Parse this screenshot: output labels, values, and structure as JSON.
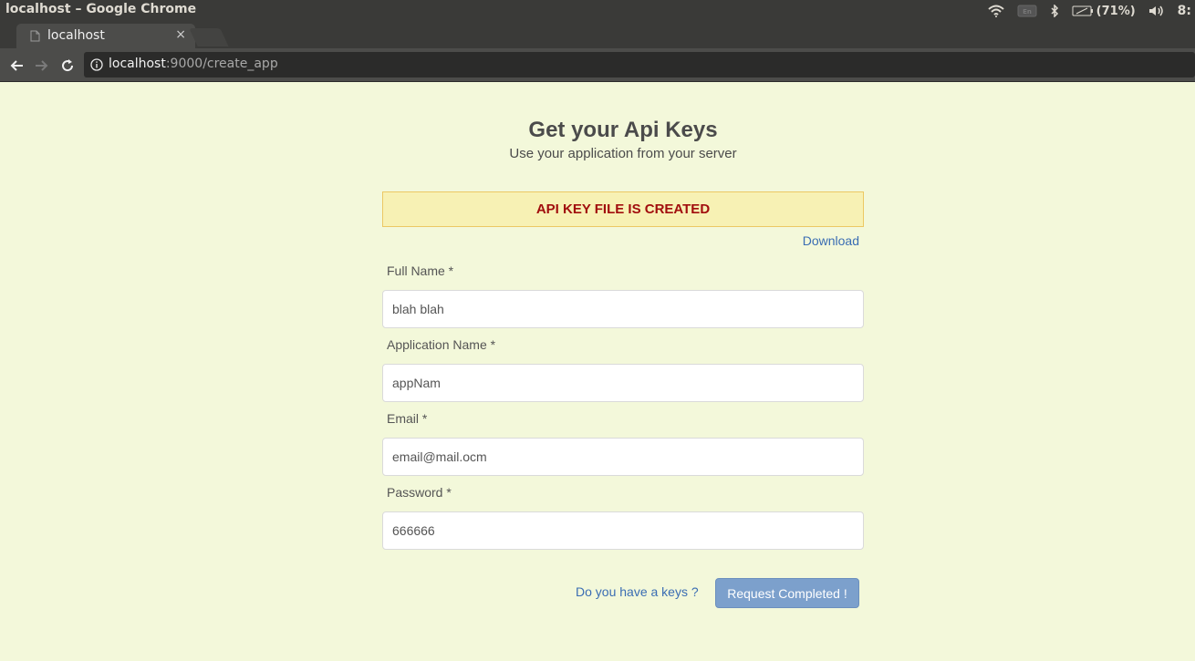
{
  "window": {
    "title": "localhost – Google Chrome"
  },
  "tray": {
    "battery_label": "(71%)",
    "clock": "8:"
  },
  "browser": {
    "tab_title": "localhost",
    "tab_close": "×",
    "url_host": "localhost",
    "url_path": ":9000/create_app"
  },
  "page": {
    "title": "Get your Api Keys",
    "subtitle": "Use your application from your server",
    "alert_text": "API KEY FILE IS CREATED",
    "download_link": "Download",
    "form": {
      "full_name_label": "Full Name *",
      "full_name_value": "blah blah",
      "app_name_label": "Application Name *",
      "app_name_value": "appNam",
      "email_label": "Email *",
      "email_value": "email@mail.ocm",
      "password_label": "Password *",
      "password_value": "666666"
    },
    "have_keys_link": "Do you have a keys ?",
    "submit_label": "Request Completed !"
  },
  "colors": {
    "page_bg": "#f3f8da",
    "alert_bg": "#f7f1b4",
    "alert_text": "#a10d0d",
    "link": "#3a6db3",
    "button": "#7ca0cc"
  },
  "icons": [
    "wifi-icon",
    "keyboard-icon",
    "bluetooth-icon",
    "battery-icon",
    "volume-icon",
    "page-favicon",
    "back-arrow-icon",
    "forward-arrow-icon",
    "reload-icon",
    "info-icon"
  ]
}
